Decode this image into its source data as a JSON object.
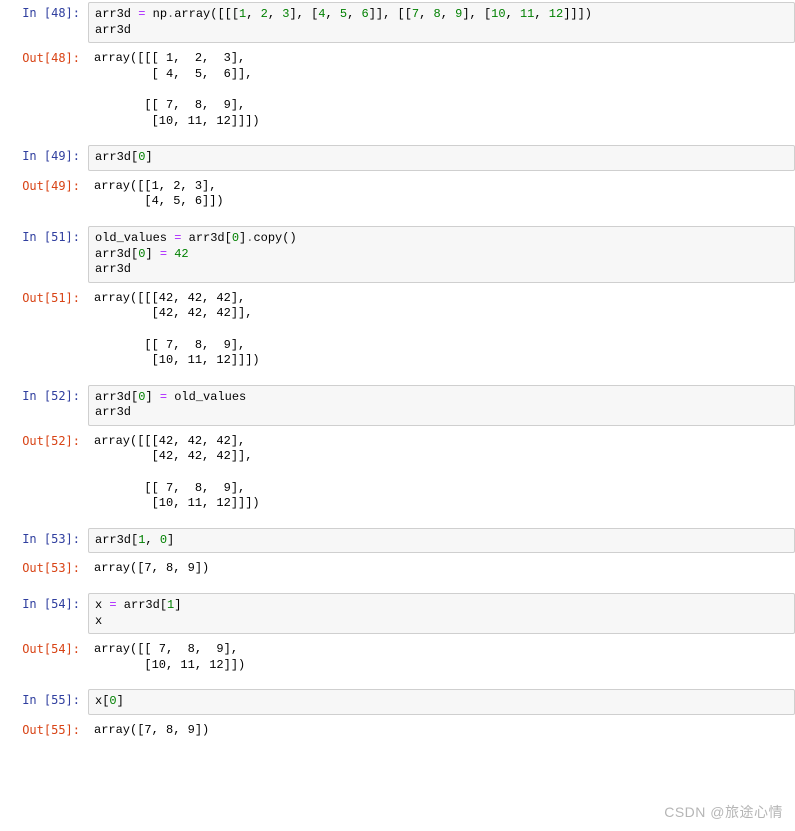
{
  "watermark": "CSDN @旅途心情",
  "cells": [
    {
      "type": "in",
      "n": "48",
      "tokens": [
        [
          "id",
          "arr3d "
        ],
        [
          "op",
          "="
        ],
        [
          "id",
          " np"
        ],
        [
          "dot",
          "."
        ],
        [
          "id",
          "array([[["
        ],
        [
          "num",
          "1"
        ],
        [
          "id",
          ", "
        ],
        [
          "num",
          "2"
        ],
        [
          "id",
          ", "
        ],
        [
          "num",
          "3"
        ],
        [
          "id",
          "], ["
        ],
        [
          "num",
          "4"
        ],
        [
          "id",
          ", "
        ],
        [
          "num",
          "5"
        ],
        [
          "id",
          ", "
        ],
        [
          "num",
          "6"
        ],
        [
          "id",
          "]], [["
        ],
        [
          "num",
          "7"
        ],
        [
          "id",
          ", "
        ],
        [
          "num",
          "8"
        ],
        [
          "id",
          ", "
        ],
        [
          "num",
          "9"
        ],
        [
          "id",
          "], ["
        ],
        [
          "num",
          "10"
        ],
        [
          "id",
          ", "
        ],
        [
          "num",
          "11"
        ],
        [
          "id",
          ", "
        ],
        [
          "num",
          "12"
        ],
        [
          "id",
          "]]])"
        ],
        [
          "nl",
          ""
        ],
        [
          "id",
          "arr3d"
        ]
      ]
    },
    {
      "type": "out",
      "n": "48",
      "text": "array([[[ 1,  2,  3],\n        [ 4,  5,  6]],\n\n       [[ 7,  8,  9],\n        [10, 11, 12]]])"
    },
    {
      "type": "in",
      "n": "49",
      "tokens": [
        [
          "id",
          "arr3d["
        ],
        [
          "num",
          "0"
        ],
        [
          "id",
          "]"
        ]
      ]
    },
    {
      "type": "out",
      "n": "49",
      "text": "array([[1, 2, 3],\n       [4, 5, 6]])"
    },
    {
      "type": "in",
      "n": "51",
      "tokens": [
        [
          "id",
          "old_values "
        ],
        [
          "op",
          "="
        ],
        [
          "id",
          " arr3d["
        ],
        [
          "num",
          "0"
        ],
        [
          "id",
          "]"
        ],
        [
          "dot",
          "."
        ],
        [
          "id",
          "copy()"
        ],
        [
          "nl",
          ""
        ],
        [
          "id",
          "arr3d["
        ],
        [
          "num",
          "0"
        ],
        [
          "id",
          "] "
        ],
        [
          "op",
          "="
        ],
        [
          "id",
          " "
        ],
        [
          "num",
          "42"
        ],
        [
          "nl",
          ""
        ],
        [
          "id",
          "arr3d"
        ]
      ]
    },
    {
      "type": "out",
      "n": "51",
      "text": "array([[[42, 42, 42],\n        [42, 42, 42]],\n\n       [[ 7,  8,  9],\n        [10, 11, 12]]])"
    },
    {
      "type": "in",
      "n": "52",
      "tokens": [
        [
          "id",
          "arr3d["
        ],
        [
          "num",
          "0"
        ],
        [
          "id",
          "] "
        ],
        [
          "op",
          "="
        ],
        [
          "id",
          " old_values"
        ],
        [
          "nl",
          ""
        ],
        [
          "id",
          "arr3d"
        ]
      ]
    },
    {
      "type": "out",
      "n": "52",
      "text": "array([[[42, 42, 42],\n        [42, 42, 42]],\n\n       [[ 7,  8,  9],\n        [10, 11, 12]]])"
    },
    {
      "type": "in",
      "n": "53",
      "tokens": [
        [
          "id",
          "arr3d["
        ],
        [
          "num",
          "1"
        ],
        [
          "id",
          ", "
        ],
        [
          "num",
          "0"
        ],
        [
          "id",
          "]"
        ]
      ]
    },
    {
      "type": "out",
      "n": "53",
      "text": "array([7, 8, 9])"
    },
    {
      "type": "in",
      "n": "54",
      "tokens": [
        [
          "id",
          "x "
        ],
        [
          "op",
          "="
        ],
        [
          "id",
          " arr3d["
        ],
        [
          "num",
          "1"
        ],
        [
          "id",
          "]"
        ],
        [
          "nl",
          ""
        ],
        [
          "id",
          "x"
        ]
      ]
    },
    {
      "type": "out",
      "n": "54",
      "text": "array([[ 7,  8,  9],\n       [10, 11, 12]])"
    },
    {
      "type": "in",
      "n": "55",
      "tokens": [
        [
          "id",
          "x["
        ],
        [
          "num",
          "0"
        ],
        [
          "id",
          "]"
        ]
      ]
    },
    {
      "type": "out",
      "n": "55",
      "text": "array([7, 8, 9])"
    }
  ]
}
